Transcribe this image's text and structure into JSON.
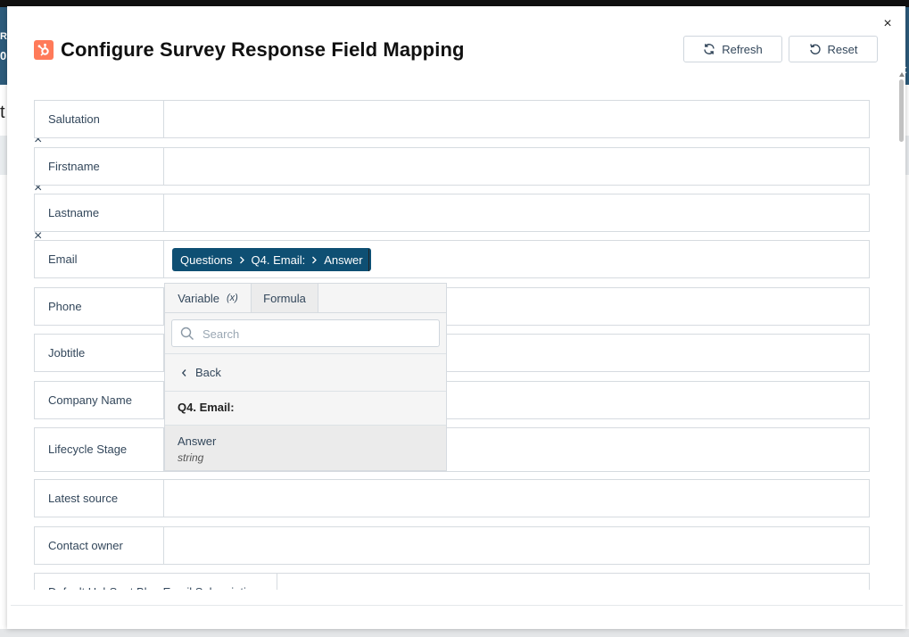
{
  "modal": {
    "title": "Configure Survey Response Field Mapping",
    "close_label": "×",
    "refresh_label": "Refresh",
    "reset_label": "Reset",
    "remove_label": "×"
  },
  "background": {
    "frag1": "R",
    "frag2": "0",
    "frag3": "t",
    "frag4": "t"
  },
  "fields": [
    {
      "label": "Salutation"
    },
    {
      "label": "Firstname"
    },
    {
      "label": "Lastname"
    },
    {
      "label": "Email"
    },
    {
      "label": "Phone"
    },
    {
      "label": "Jobtitle"
    },
    {
      "label": "Company Name"
    },
    {
      "label": "Lifecycle Stage"
    },
    {
      "label": "Latest source"
    },
    {
      "label": "Contact owner"
    },
    {
      "label": "Default HubSpot Blog Email Subscription"
    }
  ],
  "email_mapping": {
    "path": [
      "Questions",
      "Q4. Email:",
      "Answer"
    ]
  },
  "dropdown": {
    "tab_variable": "Variable",
    "tab_variable_icon": "(x)",
    "tab_formula": "Formula",
    "search_placeholder": "Search",
    "back_label": "Back",
    "group_title": "Q4. Email:",
    "option_name": "Answer",
    "option_type": "string"
  },
  "colors": {
    "chip_bg": "#0e4f73",
    "hubspot_orange": "#ff7a59",
    "backdrop_band": "#2d5b7b"
  }
}
